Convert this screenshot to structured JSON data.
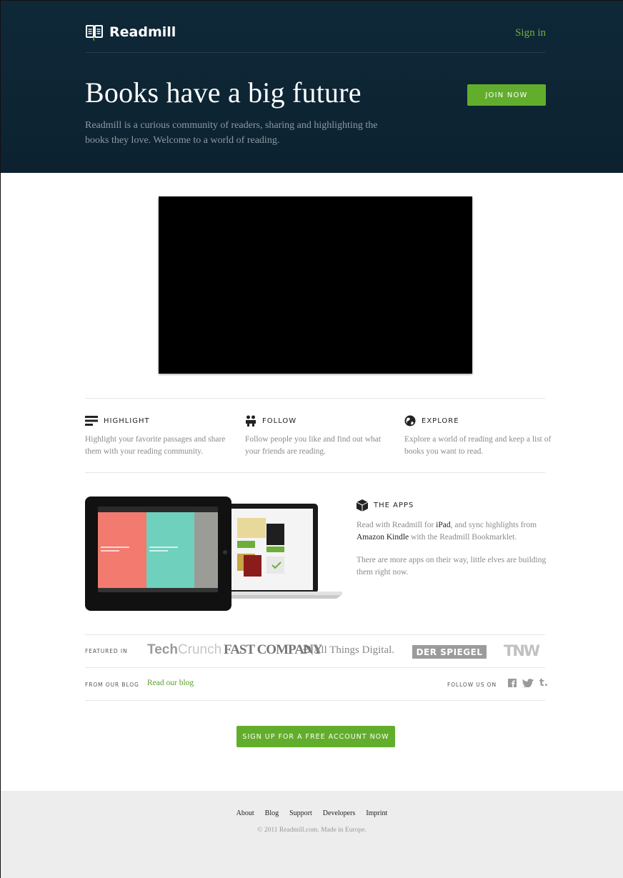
{
  "colors": {
    "hero_bg": "#0e2636",
    "accent_green": "#62ae2c",
    "link_green": "#6fb43a",
    "footer_bg": "#ededed"
  },
  "header": {
    "brand": "Readmill",
    "brand_icon": "open-book-icon",
    "signin_label": "Sign in",
    "title": "Books have a big future",
    "subtitle": "Readmill is a curious community of readers, sharing and highlighting the books they love. Welcome to a world of reading.",
    "join_label": "JOIN NOW"
  },
  "video": {
    "state": "black-placeholder"
  },
  "features": [
    {
      "icon": "highlight-lines-icon",
      "title": "HIGHLIGHT",
      "text": "Highlight your favorite passages and share them with your reading community."
    },
    {
      "icon": "people-icon",
      "title": "FOLLOW",
      "text": "Follow people you like and find out what your friends are reading."
    },
    {
      "icon": "globe-icon",
      "title": "EXPLORE",
      "text": "Explore a world of reading and keep a list of books you want to read."
    }
  ],
  "apps": {
    "icon": "cube-icon",
    "title": "THE APPS",
    "p1_a": "Read with Readmill for ",
    "p1_ipad": "iPad",
    "p1_b": ", and sync highlights from ",
    "p1_kindle": "Amazon Kindle",
    "p1_c": " with the Readmill Bookmarklet.",
    "p2": "There are more apps on their way, little elves are building them right now."
  },
  "featured": {
    "label": "FEATURED IN",
    "techcrunch_a": "Tech",
    "techcrunch_b": "Crunch",
    "fastcompany": "FAST COMPANY",
    "allthingsd": "All Things Digital.",
    "spiegel": "DER SPIEGEL",
    "tnw": "TNW"
  },
  "blog": {
    "label": "FROM OUR BLOG",
    "link": "Read our blog",
    "follow_label": "FOLLOW US ON",
    "social_icons": [
      "facebook-icon",
      "twitter-icon",
      "tumblr-icon"
    ]
  },
  "cta_label": "SIGN UP FOR A FREE ACCOUNT NOW",
  "footer": {
    "links": [
      "About",
      "Blog",
      "Support",
      "Developers",
      "Imprint"
    ],
    "copyright": "© 2011 Readmill.com. Made in Europe."
  }
}
